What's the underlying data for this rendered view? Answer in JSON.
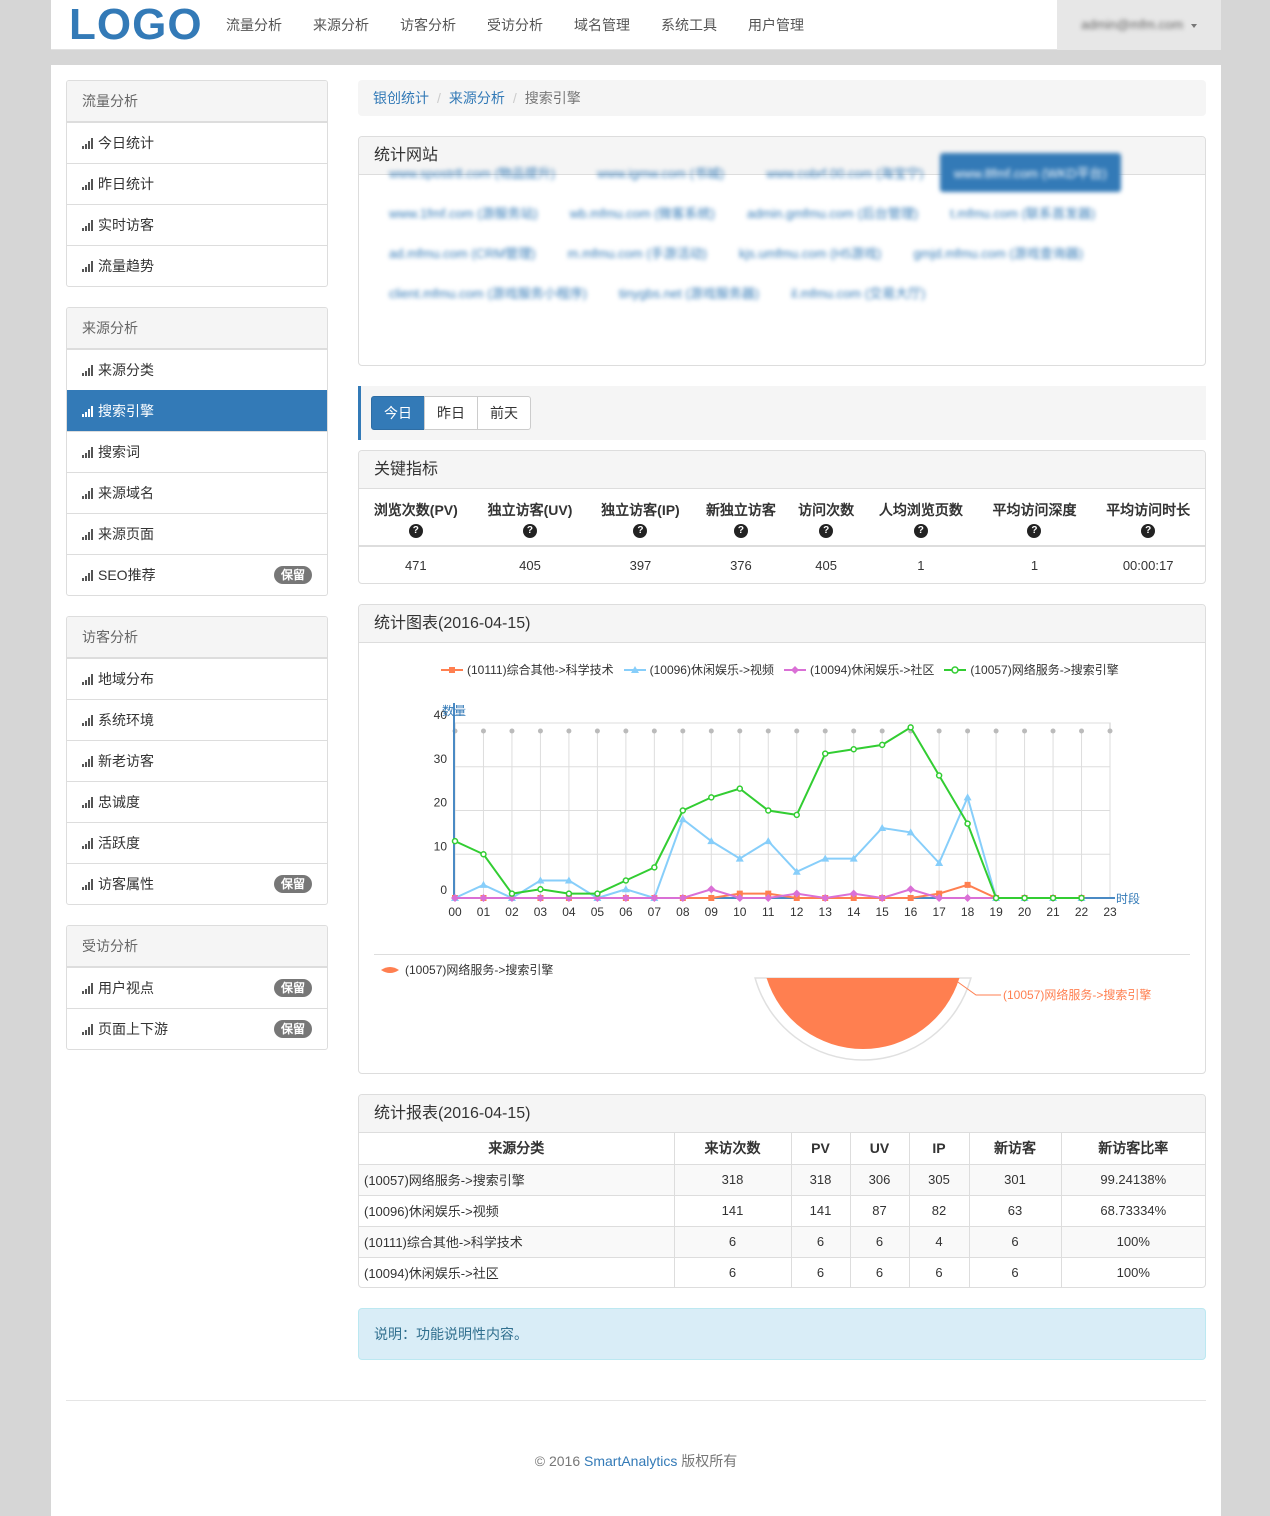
{
  "header": {
    "logo": "LOGO",
    "nav": [
      "流量分析",
      "来源分析",
      "访客分析",
      "受访分析",
      "域名管理",
      "系统工具",
      "用户管理"
    ],
    "user": "admin@mfm.com"
  },
  "sidebar": {
    "groups": [
      {
        "title": "流量分析",
        "items": [
          {
            "label": "今日统计"
          },
          {
            "label": "昨日统计"
          },
          {
            "label": "实时访客"
          },
          {
            "label": "流量趋势"
          }
        ]
      },
      {
        "title": "来源分析",
        "items": [
          {
            "label": "来源分类"
          },
          {
            "label": "搜索引擎"
          },
          {
            "label": "搜索词"
          },
          {
            "label": "来源域名"
          },
          {
            "label": "来源页面"
          },
          {
            "label": "SEO推荐",
            "badge": "保留"
          }
        ]
      },
      {
        "title": "访客分析",
        "items": [
          {
            "label": "地域分布"
          },
          {
            "label": "系统环境"
          },
          {
            "label": "新老访客"
          },
          {
            "label": "忠诚度"
          },
          {
            "label": "活跃度"
          },
          {
            "label": "访客属性",
            "badge": "保留"
          }
        ]
      },
      {
        "title": "受访分析",
        "items": [
          {
            "label": "用户视点",
            "badge": "保留"
          },
          {
            "label": "页面上下游",
            "badge": "保留"
          }
        ]
      }
    ],
    "active": "搜索引擎"
  },
  "breadcrumb": [
    "银创统计",
    "来源分析",
    "搜索引擎"
  ],
  "sites": {
    "title": "统计网站",
    "rows": [
      [
        "www.spostr8.com (物品提升)",
        "www.igmw.com (书城)",
        "www.cobrf.00.com (海宝宁)",
        "www.8fmf.com (WKD平台)"
      ],
      [
        "www.1fmf.com (游服务站)",
        "wb.mfmu.com (微客系统)",
        "admin.gmfmu.com (后台管理)",
        "t.mfmu.com (联系首发器)"
      ],
      [
        "ad.mfmu.com (CRM管理)",
        "m.mfmu.com (手游活动)",
        "kjs.umfmu.com (H5游戏)",
        "gmjd.mfmu.com (游戏查询器)"
      ],
      [
        "client.mfmu.com (游戏服务小程序)",
        "tinygbs.net (游戏服务器)",
        "il.mfmu.com (交易大厅)"
      ]
    ],
    "active": "www.8fmf.com (WKD平台)"
  },
  "days": {
    "buttons": [
      "今日",
      "昨日",
      "前天"
    ],
    "active": "今日"
  },
  "kpi": {
    "title": "关键指标",
    "headers": [
      "浏览次数(PV)",
      "独立访客(UV)",
      "独立访客(IP)",
      "新独立访客",
      "访问次数",
      "人均浏览页数",
      "平均访问深度",
      "平均访问时长"
    ],
    "values": [
      "471",
      "405",
      "397",
      "376",
      "405",
      "1",
      "1",
      "00:00:17"
    ],
    "help_icon": "question-circle-icon"
  },
  "chart_panel": {
    "title": "统计图表(2016-04-15)"
  },
  "chart_data": [
    {
      "type": "line",
      "x": [
        "00",
        "01",
        "02",
        "03",
        "04",
        "05",
        "06",
        "07",
        "08",
        "09",
        "10",
        "11",
        "12",
        "13",
        "14",
        "15",
        "16",
        "17",
        "18",
        "19",
        "20",
        "21",
        "22",
        "23"
      ],
      "ylabel": "数量",
      "xlabel": "时段",
      "ylim": [
        0,
        40
      ],
      "yticks": [
        0,
        10,
        20,
        30,
        40
      ],
      "series": [
        {
          "name": "(10111)综合其他->科学技术",
          "color": "#ff7f50",
          "marker": "square",
          "values": [
            0,
            0,
            0,
            0,
            0,
            0,
            0,
            0,
            0,
            0,
            1,
            1,
            0,
            0,
            0,
            0,
            0,
            1,
            3,
            0,
            0,
            0,
            0,
            null
          ]
        },
        {
          "name": "(10096)休闲娱乐->视频",
          "color": "#87cefa",
          "marker": "triangle",
          "values": [
            0,
            3,
            0,
            4,
            4,
            0,
            2,
            0,
            18,
            13,
            9,
            13,
            6,
            9,
            9,
            16,
            15,
            8,
            23,
            0,
            0,
            0,
            0,
            null
          ]
        },
        {
          "name": "(10094)休闲娱乐->社区",
          "color": "#da70d6",
          "marker": "diamond",
          "values": [
            0,
            0,
            0,
            0,
            0,
            0,
            0,
            0,
            0,
            2,
            0,
            0,
            1,
            0,
            1,
            0,
            2,
            0,
            0,
            0,
            0,
            0,
            0,
            null
          ]
        },
        {
          "name": "(10057)网络服务->搜索引擎",
          "color": "#32cd32",
          "marker": "circle",
          "values": [
            13,
            10,
            1,
            2,
            1,
            1,
            4,
            7,
            20,
            23,
            25,
            20,
            19,
            33,
            34,
            35,
            39,
            28,
            17,
            0,
            0,
            0,
            0,
            null
          ]
        }
      ]
    },
    {
      "type": "pie",
      "categories": [
        "(10057)网络服务->搜索引擎"
      ],
      "values": [
        318
      ],
      "color": "#ff7f50"
    }
  ],
  "report": {
    "title": "统计报表(2016-04-15)",
    "headers": [
      "来源分类",
      "来访次数",
      "PV",
      "UV",
      "IP",
      "新访客",
      "新访客比率"
    ],
    "rows": [
      [
        "(10057)网络服务->搜索引擎",
        "318",
        "318",
        "306",
        "305",
        "301",
        "99.24138%"
      ],
      [
        "(10096)休闲娱乐->视频",
        "141",
        "141",
        "87",
        "82",
        "63",
        "68.73334%"
      ],
      [
        "(10111)综合其他->科学技术",
        "6",
        "6",
        "6",
        "4",
        "6",
        "100%"
      ],
      [
        "(10094)休闲娱乐->社区",
        "6",
        "6",
        "6",
        "6",
        "6",
        "100%"
      ]
    ]
  },
  "note": "说明：功能说明性内容。",
  "footer": {
    "prefix": "© 2016 ",
    "brand": "SmartAnalytics",
    "suffix": " 版权所有"
  }
}
